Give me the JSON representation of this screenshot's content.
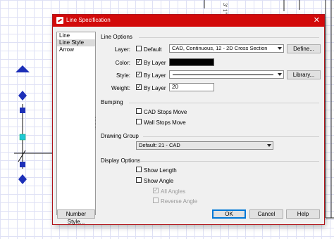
{
  "dialog": {
    "title": "Line Specification",
    "close_glyph": "✕"
  },
  "nav": {
    "items": [
      {
        "label": "Line",
        "selected": false
      },
      {
        "label": "Line Style",
        "selected": true
      },
      {
        "label": "Arrow",
        "selected": false
      }
    ]
  },
  "line_options": {
    "section_label": "Line Options",
    "layer": {
      "label": "Layer:",
      "default_label": "Default",
      "default_checked": false,
      "value": "CAD, Continuous, 12 - 2D Cross Section",
      "define_button": "Define..."
    },
    "color": {
      "label": "Color:",
      "by_layer_label": "By Layer",
      "by_layer_checked": true,
      "swatch_color": "#000000"
    },
    "style": {
      "label": "Style:",
      "by_layer_label": "By Layer",
      "by_layer_checked": true,
      "library_button": "Library..."
    },
    "weight": {
      "label": "Weight:",
      "by_layer_label": "By Layer",
      "by_layer_checked": true,
      "value": "20"
    }
  },
  "bumping": {
    "section_label": "Bumping",
    "cad_stops_move": {
      "label": "CAD Stops Move",
      "checked": false
    },
    "wall_stops_move": {
      "label": "Wall Stops Move",
      "checked": false
    }
  },
  "drawing_group": {
    "section_label": "Drawing Group",
    "value": "Default: 21 - CAD"
  },
  "display_options": {
    "section_label": "Display Options",
    "show_length": {
      "label": "Show Length",
      "checked": false
    },
    "show_angle": {
      "label": "Show Angle",
      "checked": false
    },
    "all_angles": {
      "label": "All Angles",
      "checked": true,
      "disabled": true
    },
    "reverse_angle": {
      "label": "Reverse Angle",
      "checked": false,
      "disabled": true
    }
  },
  "footer": {
    "number_style_button": "Number Style...",
    "ok_button": "OK",
    "cancel_button": "Cancel",
    "help_button": "Help"
  },
  "background": {
    "dimension_text": "3' 1\""
  },
  "colors": {
    "titlebar": "#d20a0a",
    "cad_marker": "#1c2fb8",
    "cad_marker_selected": "#1fc7d6"
  }
}
